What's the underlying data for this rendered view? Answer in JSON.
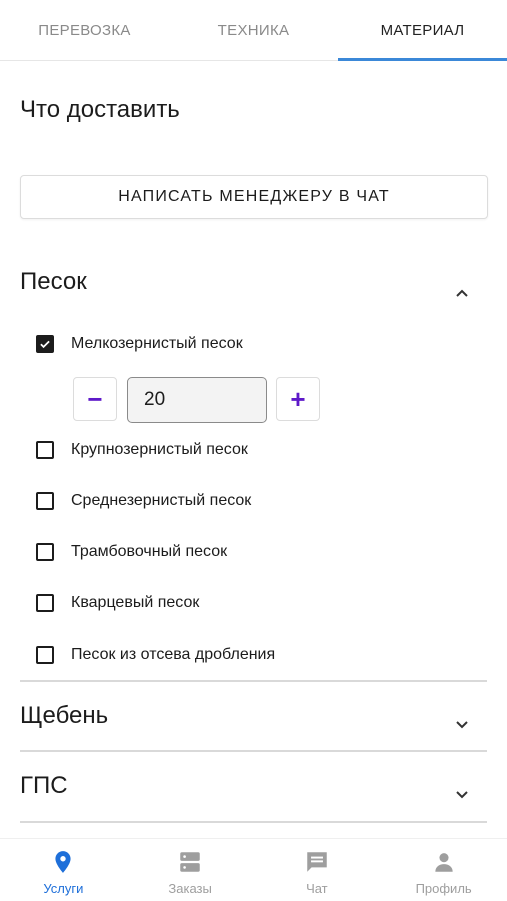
{
  "tabs": [
    {
      "label": "ПЕРЕВОЗКА",
      "active": false
    },
    {
      "label": "ТЕХНИКА",
      "active": false
    },
    {
      "label": "МАТЕРИАЛ",
      "active": true
    }
  ],
  "heading": "Что доставить",
  "chat_button": "НАПИСАТЬ МЕНЕДЖЕРУ В ЧАТ",
  "sections": [
    {
      "title": "Песок",
      "expanded": true,
      "icon": "chevron-up-icon"
    },
    {
      "title": "Щебень",
      "expanded": false,
      "icon": "chevron-down-icon"
    },
    {
      "title": "ГПС",
      "expanded": false,
      "icon": "chevron-down-icon"
    }
  ],
  "sand_items": [
    {
      "label": "Мелкозернистый песок",
      "checked": true
    },
    {
      "label": "Крупнозернистый песок",
      "checked": false
    },
    {
      "label": "Среднезернистый песок",
      "checked": false
    },
    {
      "label": "Трамбовочный песок",
      "checked": false
    },
    {
      "label": "Кварцевый песок",
      "checked": false
    },
    {
      "label": "Песок из отсева дробления",
      "checked": false
    }
  ],
  "stepper": {
    "minus": "−",
    "plus": "+",
    "value": "20"
  },
  "nav": [
    {
      "label": "Услуги",
      "icon": "location-pin-icon",
      "active": true
    },
    {
      "label": "Заказы",
      "icon": "orders-icon",
      "active": false
    },
    {
      "label": "Чат",
      "icon": "chat-icon",
      "active": false
    },
    {
      "label": "Профиль",
      "icon": "person-icon",
      "active": false
    }
  ],
  "colors": {
    "accent_tab": "#3b88d8",
    "stepper": "#5e19c9",
    "nav_active": "#1e6fd9"
  }
}
